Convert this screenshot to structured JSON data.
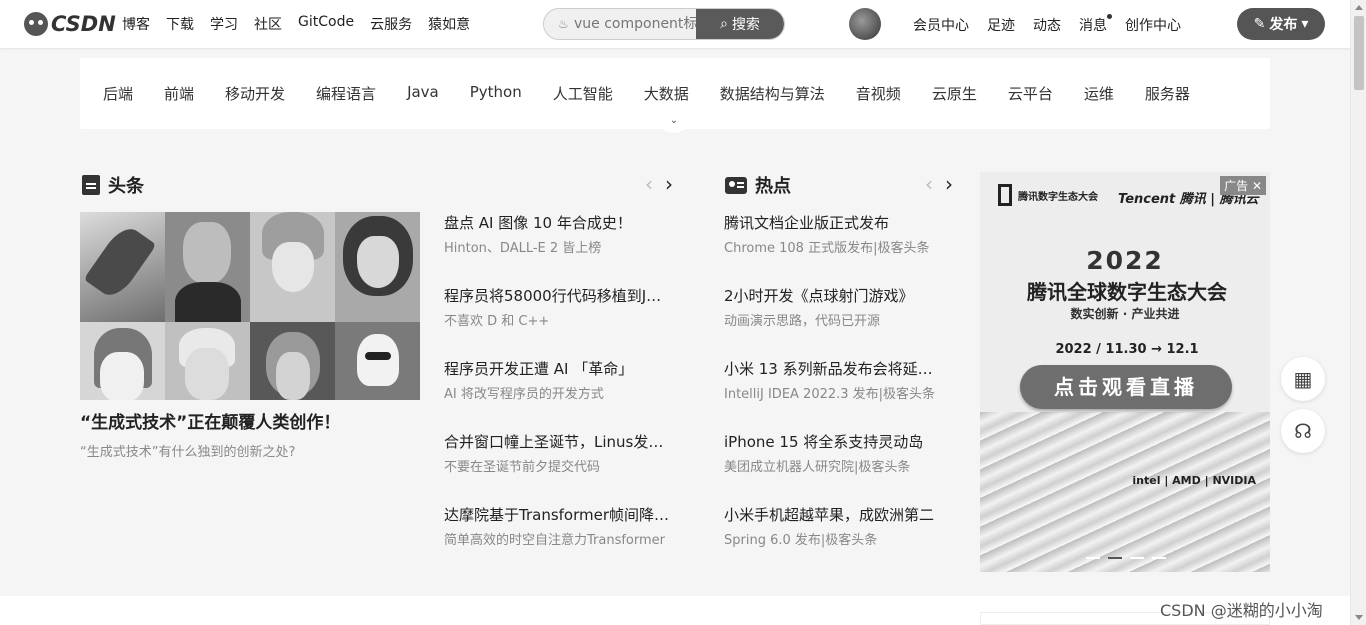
{
  "header": {
    "logo": "CSDN",
    "nav": [
      "博客",
      "下载",
      "学习",
      "社区",
      "GitCode",
      "云服务",
      "猿如意"
    ],
    "search_placeholder": "vue component标",
    "search_button": "搜索",
    "right_nav": [
      "会员中心",
      "足迹",
      "动态",
      "消息",
      "创作中心"
    ],
    "publish": "发布"
  },
  "categories": [
    "后端",
    "前端",
    "移动开发",
    "编程语言",
    "Java",
    "Python",
    "人工智能",
    "大数据",
    "数据结构与算法",
    "音视频",
    "云原生",
    "云平台",
    "运维",
    "服务器"
  ],
  "headline": {
    "title": "头条",
    "hero_title": "“生成式技术”正在颠覆人类创作！",
    "hero_sub": "“生成式技术”有什么独到的创新之处?",
    "items": [
      {
        "title": "盘点 AI 图像 10 年合成史！",
        "sub": "Hinton、DALL-E 2 皆上榜"
      },
      {
        "title": "程序员将58000行代码移植到J…",
        "sub": "不喜欢 D 和 C++"
      },
      {
        "title": "程序员开发正遭 AI 「革命」",
        "sub": "AI 将改写程序员的开发方式"
      },
      {
        "title": "合并窗口幢上圣诞节，Linus发…",
        "sub": "不要在圣诞节前夕提交代码"
      },
      {
        "title": "达摩院基于Transformer帧间降…",
        "sub": "简单高效的时空自注意力Transformer"
      }
    ]
  },
  "hot": {
    "title": "热点",
    "items": [
      {
        "title": "腾讯文档企业版正式发布",
        "sub": "Chrome 108 正式版发布|极客头条"
      },
      {
        "title": "2小时开发《点球射门游戏》",
        "sub": "动画演示思路，代码已开源"
      },
      {
        "title": "小米 13 系列新品发布会将延…",
        "sub": "IntelliJ IDEA 2022.3 发布|极客头条"
      },
      {
        "title": "iPhone 15 将全系支持灵动岛",
        "sub": "美团成立机器人研究院|极客头条"
      },
      {
        "title": "小米手机超越苹果，成欧洲第二",
        "sub": "Spring 6.0 发布|极客头条"
      }
    ]
  },
  "ad": {
    "label": "广告",
    "logo1": "腾讯数字生态大会",
    "logo2": "Tencent 腾讯 | 腾讯云",
    "year": "2022",
    "headline": "腾讯全球数字生态大会",
    "tagline": "数实创新 · 产业共进",
    "date": "2022 / 11.30 → 12.1",
    "button": "点击观看直播",
    "sponsors": "intel | AMD | NVIDIA"
  },
  "watermark": "CSDN @迷糊的小小淘"
}
